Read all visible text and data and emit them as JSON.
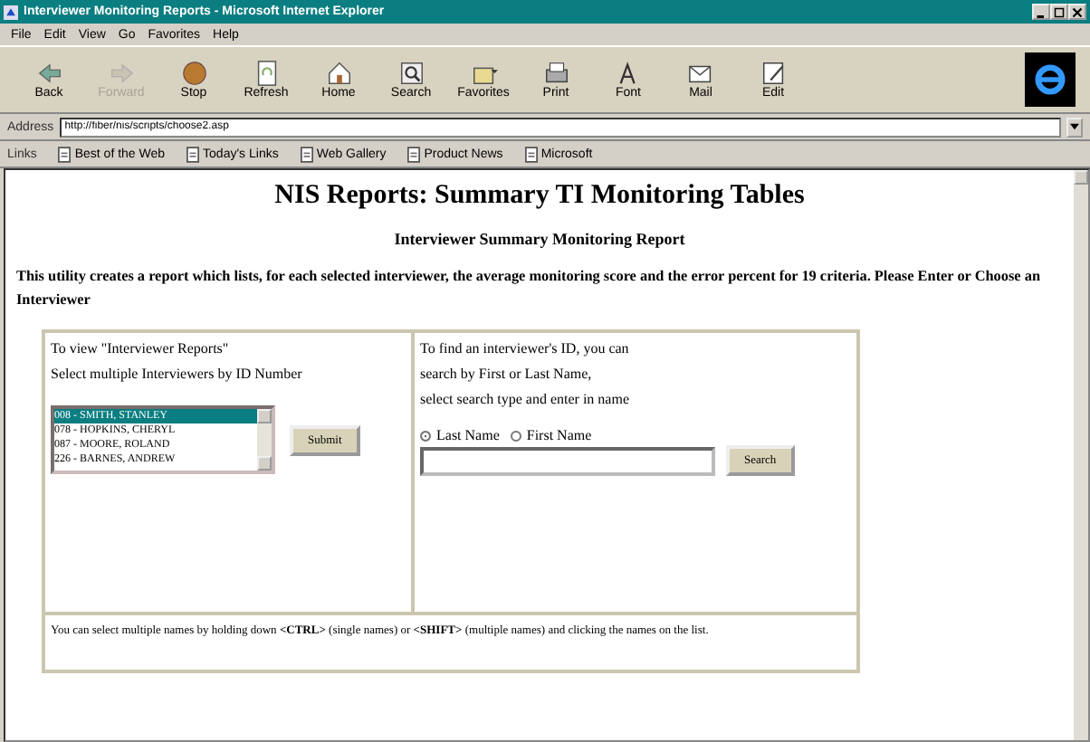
{
  "window": {
    "title": "Interviewer Monitoring Reports - Microsoft Internet Explorer"
  },
  "menu": [
    "File",
    "Edit",
    "View",
    "Go",
    "Favorites",
    "Help"
  ],
  "toolbar": [
    {
      "label": "Back",
      "kind": "back",
      "disabled": false
    },
    {
      "label": "Forward",
      "kind": "forward",
      "disabled": true
    },
    {
      "label": "Stop",
      "kind": "stop",
      "disabled": false
    },
    {
      "label": "Refresh",
      "kind": "refresh",
      "disabled": false
    },
    {
      "label": "Home",
      "kind": "home",
      "disabled": false
    },
    {
      "label": "Search",
      "kind": "search",
      "disabled": false
    },
    {
      "label": "Favorites",
      "kind": "favorites",
      "disabled": false
    },
    {
      "label": "Print",
      "kind": "print",
      "disabled": false
    },
    {
      "label": "Font",
      "kind": "font",
      "disabled": false
    },
    {
      "label": "Mail",
      "kind": "mail",
      "disabled": false
    },
    {
      "label": "Edit",
      "kind": "edit",
      "disabled": false
    }
  ],
  "address": {
    "label": "Address",
    "value": "http://fiber/nis/scripts/choose2.asp"
  },
  "links": {
    "label": "Links",
    "items": [
      "Best of the Web",
      "Today's Links",
      "Web Gallery",
      "Product News",
      "Microsoft"
    ]
  },
  "page": {
    "title": "NIS Reports: Summary TI Monitoring Tables",
    "subtitle": "Interviewer Summary Monitoring Report",
    "intro": "This utility creates a report which lists, for each selected interviewer,  the average monitoring score and the error percent for 19 criteria.   Please Enter or Choose an Interviewer",
    "left": {
      "lines": [
        "To view \"Interviewer Reports\"",
        "Select multiple Interviewers by ID Number"
      ],
      "list": [
        {
          "label": "008 - SMITH, STANLEY",
          "selected": true
        },
        {
          "label": "078 - HOPKINS, CHERYL",
          "selected": false
        },
        {
          "label": "087 - MOORE, ROLAND",
          "selected": false
        },
        {
          "label": "226 - BARNES, ANDREW",
          "selected": false
        }
      ],
      "button": "Submit"
    },
    "right": {
      "lines": [
        "To find an interviewer's ID, you can",
        "search by First or Last Name,",
        "select search type and enter in name"
      ],
      "radios": [
        {
          "label": "Last Name",
          "selected": true
        },
        {
          "label": "First Name",
          "selected": false
        }
      ],
      "button": "Search"
    },
    "footer": "You can select multiple names by holding down **<CTRL>** (single names) or **<SHIFT>** (multiple names) and clicking the names on the list."
  }
}
